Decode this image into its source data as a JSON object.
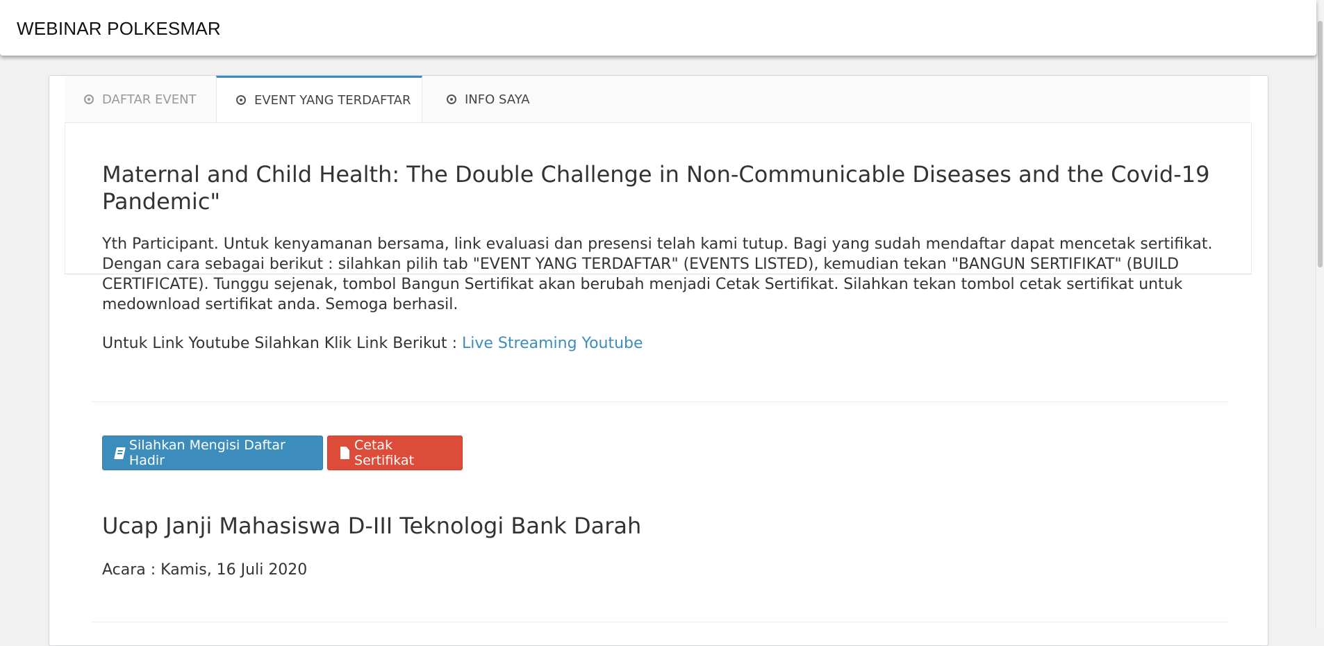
{
  "app": {
    "title": "WEBINAR POLKESMAR"
  },
  "tabs": [
    {
      "label": "DAFTAR EVENT",
      "state": "inactive"
    },
    {
      "label": "EVENT YANG TERDAFTAR",
      "state": "active"
    },
    {
      "label": "INFO SAYA",
      "state": "normal"
    }
  ],
  "event1": {
    "title": "Maternal and Child Health: The Double Challenge in Non-Communicable Diseases and the Covid-19 Pandemic\"",
    "notice": "Yth Participant. Untuk kenyamanan bersama, link evaluasi dan presensi telah kami tutup. Bagi yang sudah mendaftar dapat mencetak sertifikat. Dengan cara sebagai berikut : silahkan pilih tab \"EVENT YANG TERDAFTAR\" (EVENTS LISTED), kemudian tekan \"BANGUN SERTIFIKAT\" (BUILD CERTIFICATE). Tunggu sejenak, tombol Bangun Sertifikat akan berubah menjadi Cetak Sertifikat. Silahkan tekan tombol cetak sertifikat untuk medownload sertifikat anda. Semoga berhasil.",
    "youtube_prefix": "Untuk Link Youtube Silahkan Klik Link Berikut : ",
    "youtube_link": "Live Streaming Youtube"
  },
  "buttons": {
    "attendance": "Silahkan Mengisi Daftar Hadir",
    "certificate": "Cetak Sertifikat"
  },
  "event2": {
    "title": "Ucap Janji Mahasiswa D-III Teknologi Bank Darah",
    "date": "Acara : Kamis, 16 Juli 2020"
  },
  "colors": {
    "primary": "#3c8dbc",
    "danger": "#dd4b39",
    "background": "#f1f1f1"
  }
}
